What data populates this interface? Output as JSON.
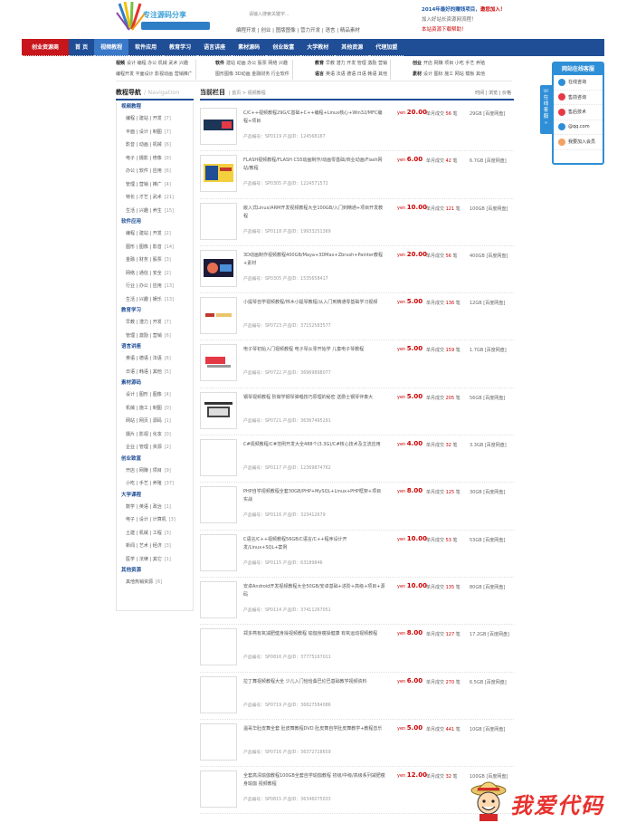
{
  "header": {
    "logo_text": "专注源码分享",
    "search_placeholder": "请输入搜索关键字...",
    "quick_links": [
      "编程开发",
      "创业",
      "图版图像",
      "营力开发",
      "语言",
      "精品素材"
    ],
    "promo_title_prefix": "2014年最好的赚钱项目，",
    "promo_title_highlight": "邀您加入！",
    "promo_line2": "加入好站长资源网流程！",
    "promo_line3": "本站资源下载帮助！"
  },
  "nav": {
    "items": [
      "创业资源商",
      "首 页",
      "视频教程",
      "软件应用",
      "教育学习",
      "语言讲座",
      "素材源码",
      "创业致富",
      "大学教材",
      "其他资源",
      "代理加盟"
    ]
  },
  "subcats": [
    {
      "head": "视频",
      "lines": [
        "设计 编程 办公 机械 武术 兴趣",
        "编程开发 平面设计 影视动画 营销推广"
      ]
    },
    {
      "head": "软件",
      "lines": [
        "建站 动画 办公 股票 网络 兴趣",
        "图形图像 3D动画 金融财务 行业软件"
      ]
    },
    {
      "head": "教育",
      "lines": [
        "早教 潜力 开发 管理 激励 营销",
        "英语 法语 德语 日语 韩语 其他"
      ]
    },
    {
      "head": "创业",
      "lines": [
        "开店 网赚 项目 小吃 手艺 养殖",
        "设计 图标 施工 网站 模板 其他"
      ]
    }
  ],
  "subcat_extra_heads": [
    "语言",
    "素材"
  ],
  "sidebar": {
    "title": "教程导航",
    "subtitle": "/ Navigation",
    "groups": [
      {
        "name": "视频教程",
        "rows": [
          [
            "编程 | 建站 | 开发",
            "[7]"
          ],
          [
            "平面 | 设计 | 制图",
            "[7]"
          ],
          [
            "影音 | 动画 | 机械",
            "[6]"
          ],
          [
            "电子 | 摄影 | 修像",
            "[9]"
          ],
          [
            "办公 | 软件 | 应用",
            "[6]"
          ],
          [
            "管理 | 营销 | 推广",
            "[4]"
          ],
          [
            "特长 | 才艺 | 武术",
            "[21]"
          ],
          [
            "生活 | 兴趣 | 养生",
            "[15]"
          ]
        ]
      },
      {
        "name": "软件应用",
        "rows": [
          [
            "编程 | 建站 | 开发",
            "[2]"
          ],
          [
            "图形 | 图像 | 影音",
            "[14]"
          ],
          [
            "金融 | 财务 | 股票",
            "[3]"
          ],
          [
            "网络 | 通信 | 安全",
            "[2]"
          ],
          [
            "行业 | 办公 | 应用",
            "[13]"
          ],
          [
            "生活 | 兴趣 | 娱乐",
            "[13]"
          ]
        ]
      },
      {
        "name": "教育学习",
        "rows": [
          [
            "早教 | 潜力 | 开发",
            "[7]"
          ],
          [
            "管理 | 激励 | 营销",
            "[6]"
          ]
        ]
      },
      {
        "name": "语言讲座",
        "rows": [
          [
            "英语 | 德语 | 法语",
            "[6]"
          ],
          [
            "日语 | 韩语 | 其他",
            "[5]"
          ]
        ]
      },
      {
        "name": "素材源码",
        "rows": [
          [
            "设计 | 图形 | 图像",
            "[4]"
          ],
          [
            "机械 | 施工 | 制图",
            "[0]"
          ],
          [
            "网站 | 网页 | 源码",
            "[1]"
          ],
          [
            "摄片 | 影视 | 化妆",
            "[0]"
          ],
          [
            "企业 | 管理 | 资源",
            "[2]"
          ]
        ]
      },
      {
        "name": "创业致富",
        "rows": [
          [
            "开店 | 网赚 | 项目",
            "[9]"
          ],
          [
            "小吃 | 手艺 | 养殖",
            "[37]"
          ]
        ]
      },
      {
        "name": "大学课程",
        "rows": [
          [
            "数学 | 英语 | 政治",
            "[1]"
          ],
          [
            "电子 | 设计 | 计算机",
            "[3]"
          ],
          [
            "土建 | 机械 | 工程",
            "[3]"
          ],
          [
            "新闻 | 艺术 | 经济",
            "[3]"
          ],
          [
            "医学 | 法律 | 其它",
            "[1]"
          ]
        ]
      },
      {
        "name": "其他资源",
        "rows": [
          [
            "其他热销资源",
            "[6]"
          ]
        ]
      }
    ]
  },
  "main": {
    "title": "当前栏目",
    "breadcrumb": "| 首页 > 视频教程",
    "sort_labels": [
      "时间",
      "浏览",
      "价格"
    ],
    "price_unit": "yen",
    "sold_label": "单月成交",
    "sold_unit": "笔",
    "code_label": "产品编号：",
    "id_label": "产品ID：",
    "items": [
      {
        "title": "C/C++视频教程29G/C基础+C++编程+Linux核心+Win32/MFC编程+项目",
        "code": "SP0119",
        "id": "124568167",
        "price": "20.00",
        "sold": "56",
        "size": "29GB [百度网盘]",
        "thumb": "dark"
      },
      {
        "title": "FLASH视频教程/FLASH CS5动画制作/动画零基础/商业动画/Flash网站/教程",
        "code": "SP0305",
        "id": "1224571572",
        "price": "6.00",
        "sold": "42",
        "size": "6.7GB [百度网盘]",
        "thumb": "flash"
      },
      {
        "title": "嵌入式Linux/ARM开发视频教程大全100GB/入门到精通+项目开发教程",
        "code": "SP0118",
        "id": "19933251369",
        "price": "10.00",
        "sold": "121",
        "size": "100GB [百度网盘]",
        "thumb": "blank"
      },
      {
        "title": "3D动画制作视频教程400GB/Maya+3DMax+Zbrush+Painter教程+素材",
        "code": "SP0305",
        "id": "1535658417",
        "price": "20.00",
        "sold": "56",
        "size": "400GB [百度网盘]",
        "thumb": "3d"
      },
      {
        "title": "小提琴自学视频教程/林木小提琴教程/从入门到精通零基础学习视频",
        "code": "SP0723",
        "id": "37152583577",
        "price": "5.00",
        "sold": "136",
        "size": "12GB [百度网盘]",
        "thumb": "violin"
      },
      {
        "title": "电子琴初始入门视频教程 电子琴从零开始学 儿童电子琴教程",
        "code": "SP0722",
        "id": "36969898077",
        "price": "5.00",
        "sold": "159",
        "size": "1.7GB [百度网盘]",
        "thumb": "keys"
      },
      {
        "title": "钢琴视频教程 阶做学钢琴弹唱技巧原理的秘密 送爵士钢琴伴奏大",
        "code": "SP0721",
        "id": "36367495291",
        "price": "5.00",
        "sold": "205",
        "size": "56GB [百度网盘]",
        "thumb": "piano"
      },
      {
        "title": "C#视频教程/C#范例开发大全488个(3.3G)/C#核心技术及主流应用",
        "code": "SP0117",
        "id": "12369874762",
        "price": "4.00",
        "sold": "32",
        "size": "3.3GB [百度网盘]",
        "thumb": "blank"
      },
      {
        "title": "PHP自学视频教程全套30GB/PHP+MySQL+Linux+PHP框架+项目实战",
        "code": "SP0116",
        "id": "323412679",
        "price": "8.00",
        "sold": "125",
        "size": "30GB [百度网盘]",
        "thumb": "blank"
      },
      {
        "title": "C语言/C++视频教程56GB/C语言/C++程序设计开发/Linux+SQL+案例",
        "code": "SP0115",
        "id": "63189846",
        "price": "10.00",
        "sold": "53",
        "size": "53GB [百度网盘]",
        "thumb": "blank"
      },
      {
        "title": "安卓Android开发视频教程大全50GB/安卓基础+进阶+高级+项目+源码",
        "code": "SP0114",
        "id": "37411267051",
        "price": "10.00",
        "sold": "135",
        "size": "80GB [百度网盘]",
        "thumb": "blank"
      },
      {
        "title": "郑多燕有氧减肥健身操视频教程 瑜伽身瘦操健康 有氧运动视频教程",
        "code": "SP0816",
        "id": "37775167011",
        "price": "8.00",
        "sold": "127",
        "size": "17.2GB [百度网盘]",
        "thumb": "blank"
      },
      {
        "title": "拉丁舞视频教程大全 少儿入门恰恰桑巴伦巴基础教学视频资料",
        "code": "SP0719",
        "id": "36827584086",
        "price": "6.00",
        "sold": "270",
        "size": "6.5GB [百度网盘]",
        "thumb": "blank"
      },
      {
        "title": "温哥华肚皮舞全套 肚皮舞教程DVD 肚皮舞自学肚皮舞教学+教程音乐",
        "code": "SP0716",
        "id": "36372728659",
        "price": "5.00",
        "sold": "441",
        "size": "10GB [百度网盘]",
        "thumb": "blank"
      },
      {
        "title": "全套高清瑜伽教程100GB全套自学瑜伽教程 初级/中级/高级系列减肥瘦身瑜伽 视频教程",
        "code": "SP0815",
        "id": "36346075033",
        "price": "12.00",
        "sold": "32",
        "size": "100GB [百度网盘]",
        "thumb": "blank"
      }
    ]
  },
  "panel": {
    "title": "网站在线客服",
    "side_tab": "在线客服",
    "rows": [
      "在线咨询",
      "售前咨询",
      "售后技术",
      "@qq.com",
      "我要加入会员"
    ]
  },
  "watermark": {
    "text": "我爱代码"
  }
}
